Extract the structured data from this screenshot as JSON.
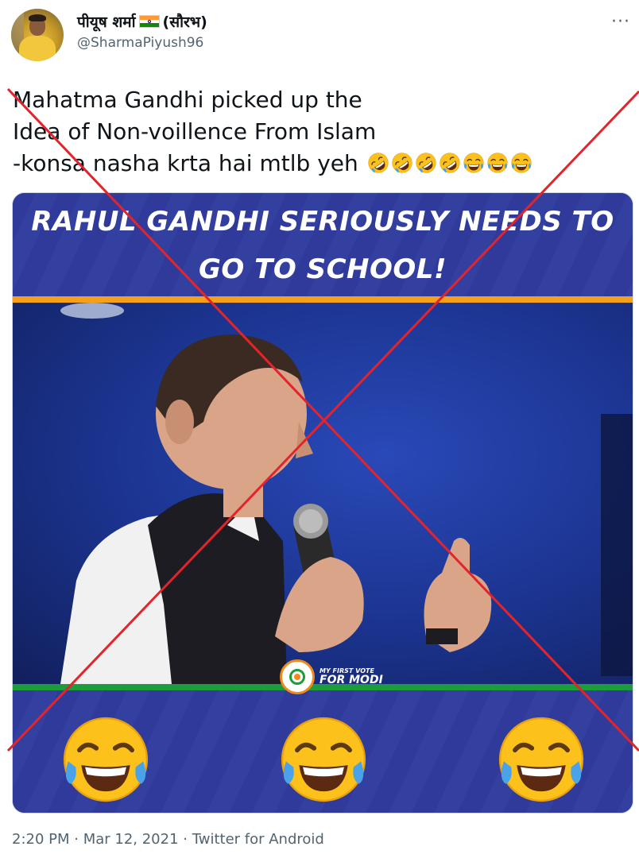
{
  "author": {
    "display_name": "पीयूष शर्मा",
    "name_suffix": "(सौरभ)",
    "handle": "@SharmaPiyush96"
  },
  "tweet": {
    "lines": [
      "Mahatma Gandhi picked up the",
      "Idea of Non-voillence From Islam",
      "-konsa nasha krta hai mtlb yeh"
    ],
    "trailing_emojis": [
      "rolling-on-floor-laughing",
      "rolling-on-floor-laughing",
      "rolling-on-floor-laughing",
      "rolling-on-floor-laughing",
      "face-with-tears-of-joy",
      "face-with-tears-of-joy",
      "face-with-tears-of-joy"
    ]
  },
  "media": {
    "headline_line1": "RAHUL GANDHI SERIOUSLY NEEDS TO",
    "headline_line2": "GO TO SCHOOL!",
    "logo_text_small": "MY FIRST VOTE",
    "logo_text_large": "FOR MODI",
    "bottom_emojis": [
      "face-with-tears-of-joy",
      "face-with-tears-of-joy",
      "face-with-tears-of-joy"
    ]
  },
  "meta": {
    "time": "2:20 PM",
    "separator": " · ",
    "date": "Mar 12, 2021",
    "source": "Twitter for Android"
  },
  "colors": {
    "cross": "#e3242b",
    "banner_blue": "#2f3a9a",
    "orange_stripe": "#f5a01b",
    "green_stripe": "#1c9c3a",
    "handle_gray": "#536471"
  }
}
